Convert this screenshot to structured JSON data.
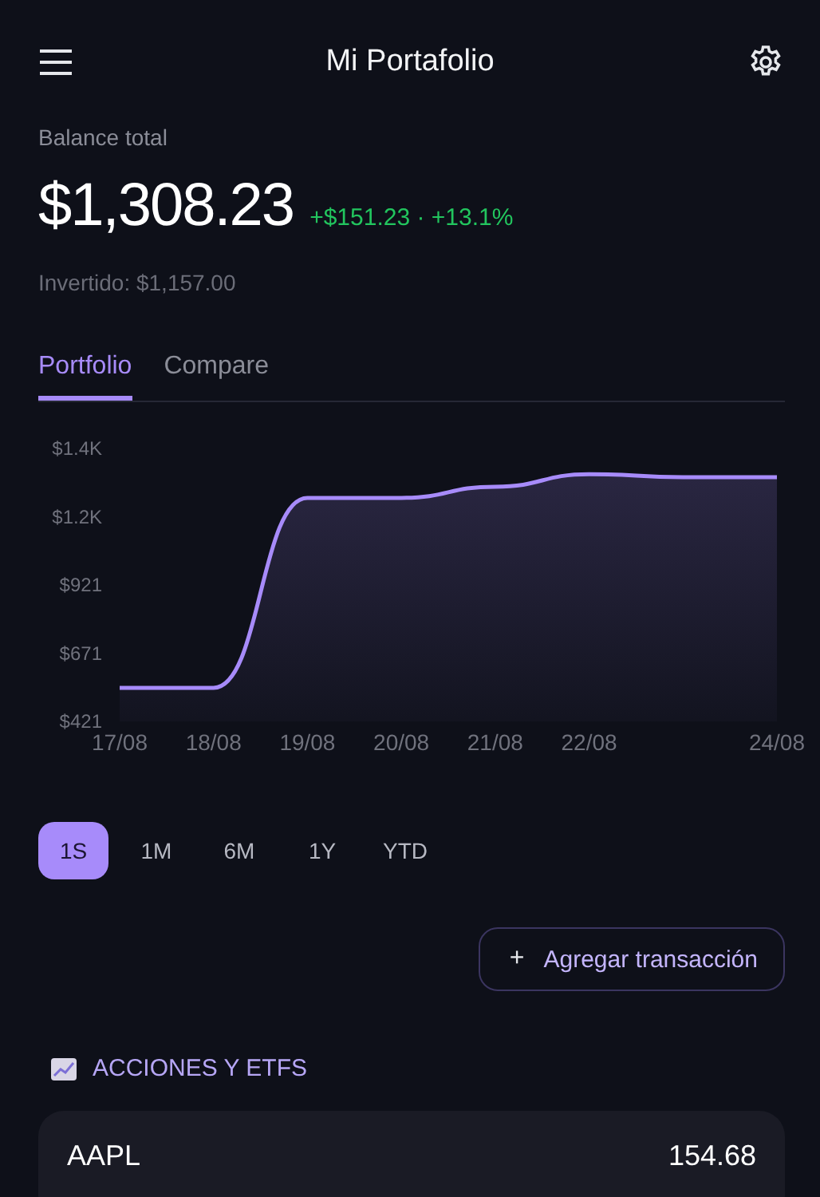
{
  "header": {
    "title": "Mi Portafolio"
  },
  "balance": {
    "label": "Balance total",
    "amount": "$1,308.23",
    "change": "+$151.23 · +13.1%",
    "invested": "Invertido: $1,157.00"
  },
  "tabs": [
    {
      "label": "Portfolio",
      "selected": true
    },
    {
      "label": "Compare",
      "selected": false
    }
  ],
  "chart_data": {
    "type": "area",
    "categories": [
      "17/08",
      "18/08",
      "19/08",
      "20/08",
      "21/08",
      "22/08",
      null,
      "24/08"
    ],
    "series": [
      {
        "color": "#a78bfa",
        "values": [
          544,
          544,
          1240,
          1240,
          1281,
          1327,
          1316,
          1316
        ]
      }
    ],
    "ylim": [
      421,
      1421
    ],
    "yticks": [
      {
        "value": 421,
        "label": "$421"
      },
      {
        "value": 671,
        "label": "$671"
      },
      {
        "value": 921,
        "label": "$921"
      },
      {
        "value": 1171,
        "label": "$1.2K"
      },
      {
        "value": 1421,
        "label": "$1.4K"
      }
    ]
  },
  "periods": [
    {
      "label": "1S",
      "selected": true
    },
    {
      "label": "1M",
      "selected": false
    },
    {
      "label": "6M",
      "selected": false
    },
    {
      "label": "1Y",
      "selected": false
    },
    {
      "label": "YTD",
      "selected": false
    }
  ],
  "add_button": {
    "icon": "+",
    "label": "Agregar transacción"
  },
  "section": {
    "title": "ACCIONES Y ETFS"
  },
  "holdings": [
    {
      "symbol": "AAPL",
      "price": "154.68"
    }
  ]
}
